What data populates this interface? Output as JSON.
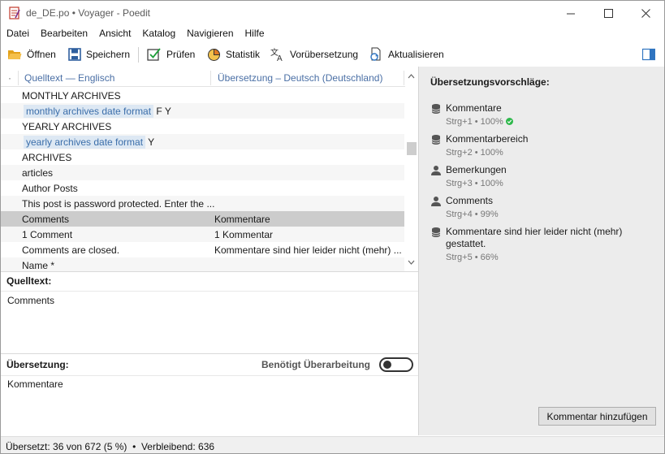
{
  "window": {
    "title": "de_DE.po • Voyager - Poedit",
    "controls": {
      "minimize": "—",
      "maximize": "☐",
      "close": "✕"
    }
  },
  "menu": [
    "Datei",
    "Bearbeiten",
    "Ansicht",
    "Katalog",
    "Navigieren",
    "Hilfe"
  ],
  "toolbar": {
    "open": "Öffnen",
    "save": "Speichern",
    "validate": "Prüfen",
    "stats": "Statistik",
    "pretranslate": "Vorübersetzung",
    "update": "Aktualisieren",
    "icons": {
      "open": "folder-icon",
      "save": "floppy-icon",
      "validate": "checkbox-icon",
      "stats": "pie-chart-icon",
      "pretranslate": "translate-icon",
      "update": "refresh-file-icon",
      "sidebar": "sidebar-toggle-icon"
    }
  },
  "list": {
    "headers": {
      "marker": "·",
      "source": "Quelltext — Englisch",
      "translation": "Übersetzung – Deutsch (Deutschland)"
    },
    "rows": [
      {
        "source": "MONTHLY ARCHIVES",
        "context": "",
        "suffix": "",
        "translation": ""
      },
      {
        "source": "",
        "context": "monthly archives date format",
        "suffix": " F Y",
        "translation": ""
      },
      {
        "source": "YEARLY ARCHIVES",
        "context": "",
        "suffix": "",
        "translation": ""
      },
      {
        "source": "",
        "context": "yearly archives date format",
        "suffix": " Y",
        "translation": ""
      },
      {
        "source": "ARCHIVES",
        "context": "",
        "suffix": "",
        "translation": ""
      },
      {
        "source": "articles",
        "context": "",
        "suffix": "",
        "translation": ""
      },
      {
        "source": "Author Posts",
        "context": "",
        "suffix": "",
        "translation": ""
      },
      {
        "source": "This post is password protected. Enter the ...",
        "context": "",
        "suffix": "",
        "translation": ""
      },
      {
        "source": "Comments",
        "context": "",
        "suffix": "",
        "translation": "Kommentare",
        "selected": true
      },
      {
        "source": "1 Comment",
        "context": "",
        "suffix": "",
        "translation": "1 Kommentar"
      },
      {
        "source": "Comments are closed.",
        "context": "",
        "suffix": "",
        "translation": "Kommentare sind hier leider nicht (mehr) ..."
      },
      {
        "source": "Name *",
        "context": "",
        "suffix": "",
        "translation": ""
      }
    ]
  },
  "source_pane": {
    "label": "Quelltext:",
    "text": "Comments"
  },
  "translation_pane": {
    "label": "Übersetzung:",
    "needs_work_label": "Benötigt Überarbeitung",
    "needs_work_on": false,
    "text": "Kommentare"
  },
  "sidebar": {
    "title": "Übersetzungsvorschläge:",
    "suggestions": [
      {
        "icon": "database-icon",
        "text": "Kommentare",
        "meta": "Strg+1 • 100%",
        "exact": true
      },
      {
        "icon": "database-icon",
        "text": "Kommentarbereich",
        "meta": "Strg+2 • 100%"
      },
      {
        "icon": "person-icon",
        "text": "Bemerkungen",
        "meta": "Strg+3 • 100%"
      },
      {
        "icon": "person-icon",
        "text": "Comments",
        "meta": "Strg+4 • 99%"
      },
      {
        "icon": "database-icon",
        "text": "Kommentare sind hier leider nicht (mehr) gestattet.",
        "meta": "Strg+5 • 66%"
      }
    ],
    "add_comment": "Kommentar hinzufügen"
  },
  "status": {
    "translated": "Übersetzt: 36 von 672 (5 %)",
    "separator": "•",
    "remaining": "Verbleibend: 636"
  },
  "colors": {
    "context_bg": "#dde8f3",
    "context_fg": "#3b6eaa",
    "selected_row": "#cccccc",
    "header_text": "#4a6fa5",
    "exact_match": "#2eb84b",
    "sidebar_bg": "#ececec"
  }
}
